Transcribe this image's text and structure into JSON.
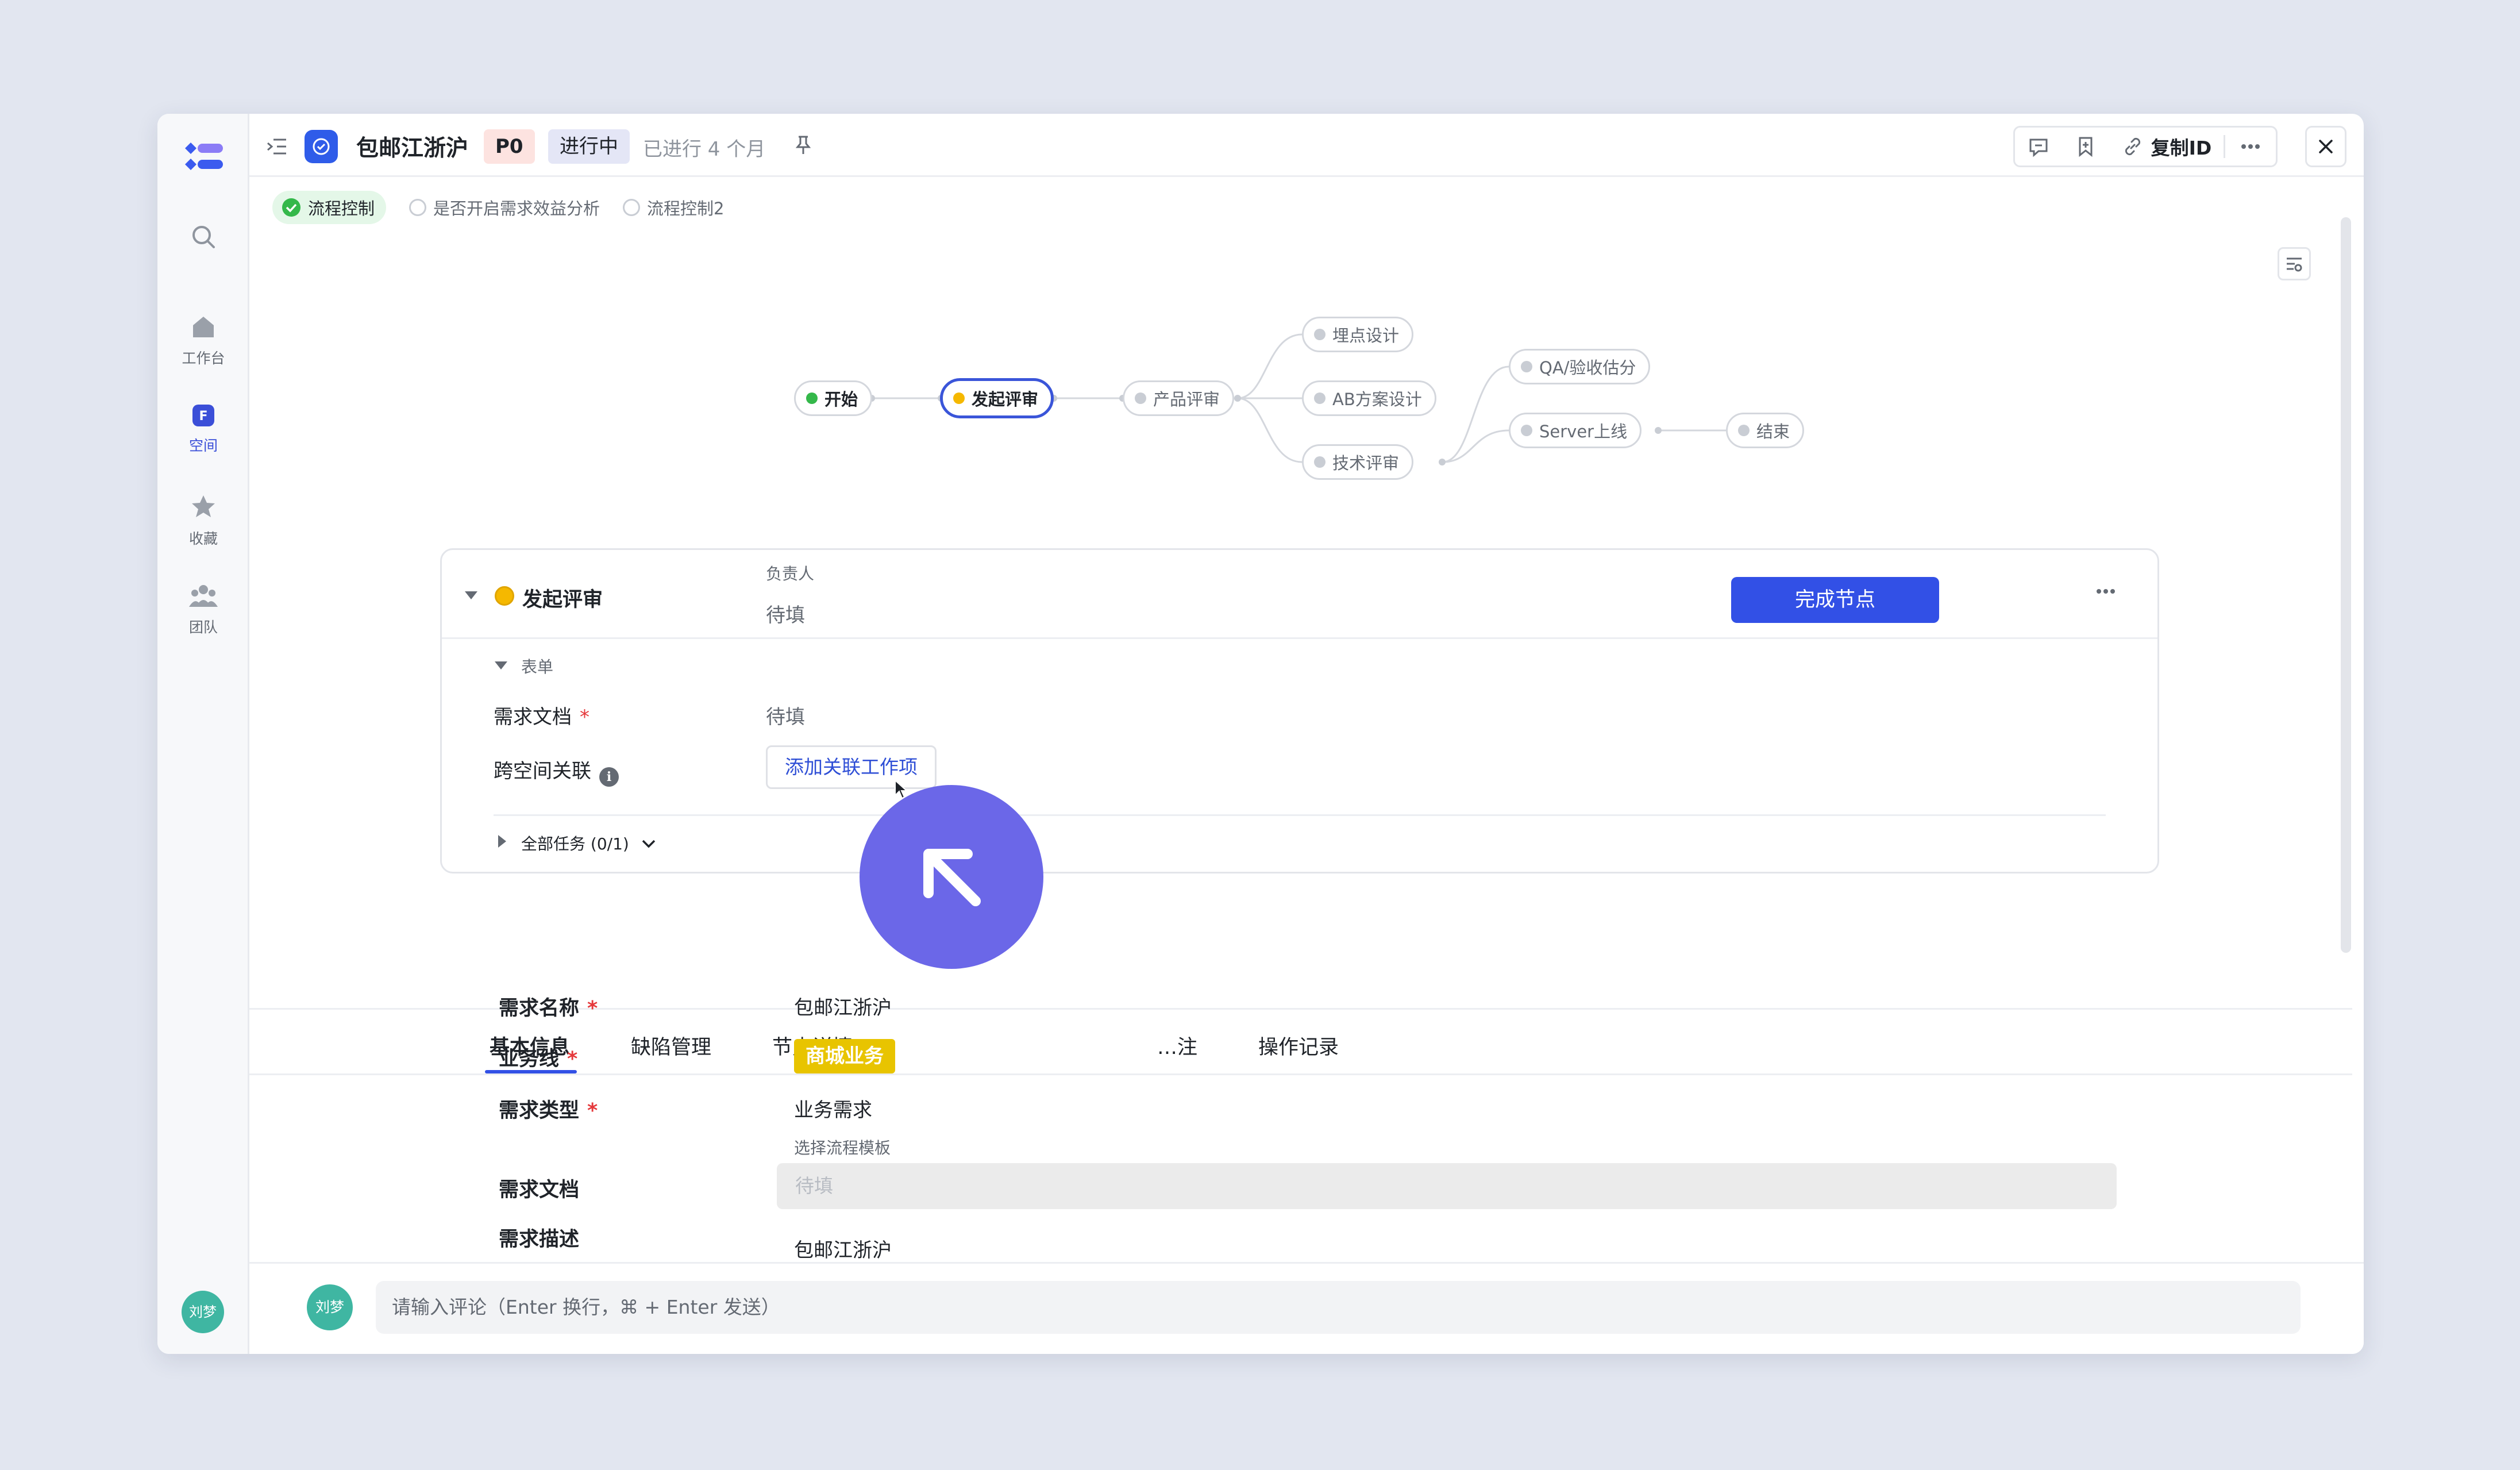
{
  "colors": {
    "accent": "#3250e6",
    "done": "#34b84a",
    "current": "#f5b800",
    "business_tag": "#e8c400",
    "cursor_circle": "#6b67e8"
  },
  "rail": {
    "items": [
      {
        "icon": "search-icon",
        "label": ""
      },
      {
        "icon": "home-icon",
        "label": "工作台"
      },
      {
        "icon": "space-icon",
        "label": "空间"
      },
      {
        "icon": "star-icon",
        "label": "收藏"
      },
      {
        "icon": "team-icon",
        "label": "团队"
      }
    ],
    "avatar": "刘梦"
  },
  "header": {
    "title": "包邮江浙沪",
    "priority": "P0",
    "status": "进行中",
    "elapsed": "已进行 4 个月",
    "copy_id": "复制ID"
  },
  "flow_tabs": [
    {
      "label": "流程控制",
      "active": true
    },
    {
      "label": "是否开启需求效益分析",
      "active": false
    },
    {
      "label": "流程控制2",
      "active": false
    }
  ],
  "flow_nodes": {
    "start": "开始",
    "review_init": "发起评审",
    "product_review": "产品评审",
    "tracking_design": "埋点设计",
    "ab_design": "AB方案设计",
    "tech_review": "技术评审",
    "qa_estimate": "QA/验收估分",
    "server_launch": "Server上线",
    "end": "结束"
  },
  "node_panel": {
    "title": "发起评审",
    "owner_label": "负责人",
    "owner_value": "待填",
    "complete_button": "完成节点",
    "form_section": "表单",
    "doc_label": "需求文档",
    "doc_value": "待填",
    "cross_link_label": "跨空间关联",
    "add_link_button": "添加关联工作项",
    "all_tasks": "全部任务 (0/1)"
  },
  "bottom_tabs": [
    "基本信息",
    "缺陷管理",
    "节点详情",
    "…注",
    "操作记录"
  ],
  "basic_info": {
    "name_label": "需求名称",
    "name_value": "包邮江浙沪",
    "biz_label": "业务线",
    "biz_value": "商城业务",
    "type_label": "需求类型",
    "type_value": "业务需求",
    "template_label": "选择流程模板",
    "doc_label": "需求文档",
    "doc_placeholder": "待填",
    "desc_label": "需求描述",
    "desc_value": "包邮江浙沪"
  },
  "comment": {
    "avatar": "刘梦",
    "placeholder": "请输入评论（Enter 换行，⌘ + Enter 发送）"
  }
}
